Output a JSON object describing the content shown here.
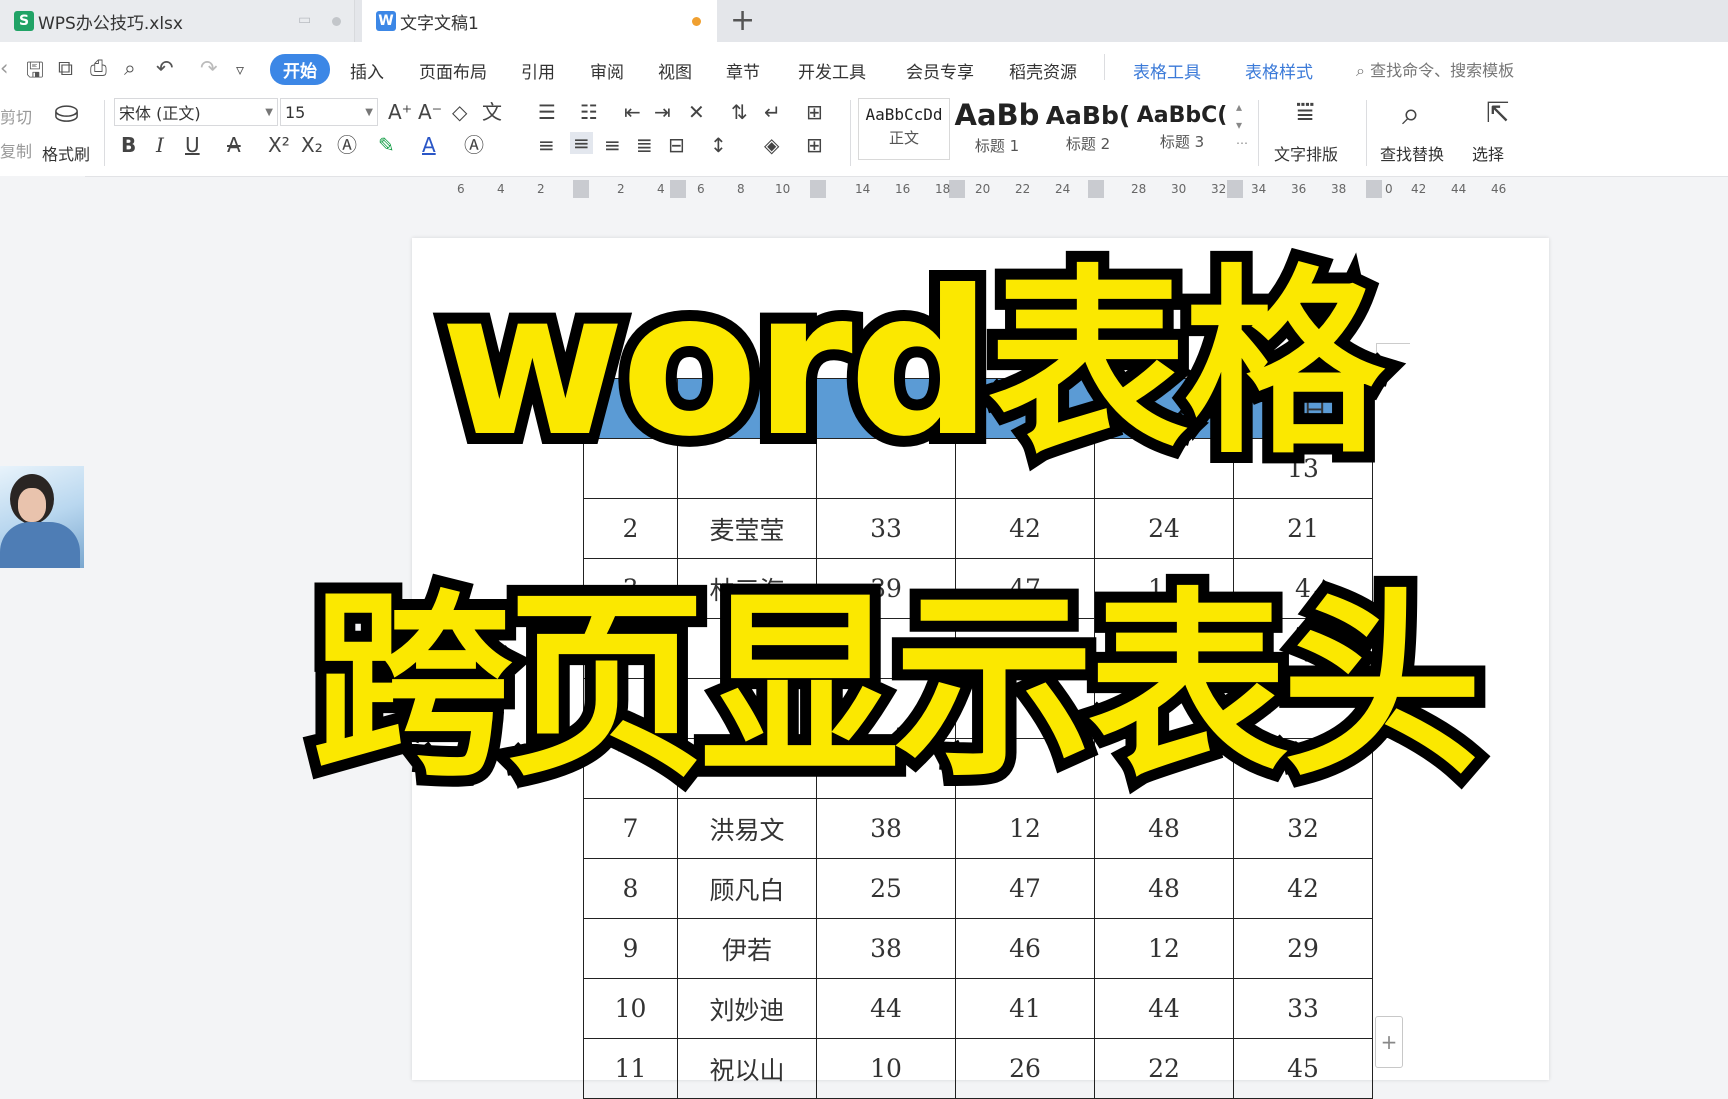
{
  "tabs": [
    {
      "icon_letter": "S",
      "icon_color": "#21a366",
      "title": "WPS办公技巧.xlsx"
    },
    {
      "icon_letter": "W",
      "icon_color": "#3c87e6",
      "title": "文字文稿1",
      "unsaved_dot_color": "#f0a030"
    }
  ],
  "new_tab_icon": "plus-icon",
  "menu": {
    "items": [
      "开始",
      "插入",
      "页面布局",
      "引用",
      "审阅",
      "视图",
      "章节",
      "开发工具",
      "会员专享",
      "稻壳资源"
    ],
    "active": "开始",
    "context_tabs": [
      "表格工具",
      "表格样式"
    ],
    "search_placeholder": "查找命令、搜索模板"
  },
  "ribbon": {
    "cut_label": "剪切",
    "copy_label": "复制",
    "format_painter_label": "格式刷",
    "font_name": "宋体 (正文)",
    "font_size": "15",
    "styles": [
      {
        "sample": "AaBbCcDd",
        "name": "正文"
      },
      {
        "sample": "AaBb",
        "name": "标题 1"
      },
      {
        "sample": "AaBb(",
        "name": "标题 2"
      },
      {
        "sample": "AaBbC(",
        "name": "标题 3"
      }
    ],
    "text_layout_label": "文字排版",
    "find_replace_label": "查找替换",
    "select_label": "选择"
  },
  "ruler_ticks": [
    "6",
    "4",
    "2",
    "2",
    "4",
    "6",
    "8",
    "10",
    "14",
    "16",
    "18",
    "20",
    "22",
    "24",
    "28",
    "30",
    "32",
    "34",
    "36",
    "38",
    "0",
    "42",
    "44",
    "46"
  ],
  "table": {
    "header_fragment": "4 日",
    "header_color": "#5b9bd5",
    "rows": [
      [
        "",
        "",
        "",
        "",
        "",
        "13"
      ],
      [
        "2",
        "麦莹莹",
        "33",
        "42",
        "24",
        "21"
      ],
      [
        "3",
        "林三海",
        "39",
        "47",
        "15",
        "4"
      ],
      [
        "",
        "",
        "",
        "",
        "",
        ""
      ],
      [
        "",
        "",
        "",
        "",
        "",
        ""
      ],
      [
        "",
        "",
        "",
        "",
        "",
        "0"
      ],
      [
        "7",
        "洪易文",
        "38",
        "12",
        "48",
        "32"
      ],
      [
        "8",
        "顾凡白",
        "25",
        "47",
        "48",
        "42"
      ],
      [
        "9",
        "伊若",
        "38",
        "46",
        "12",
        "29"
      ],
      [
        "10",
        "刘妙迪",
        "44",
        "41",
        "44",
        "33"
      ],
      [
        "11",
        "祝以山",
        "10",
        "26",
        "22",
        "45"
      ]
    ]
  },
  "overlay": {
    "line1": "word表格",
    "line2": "跨页显示表头",
    "fill_color": "#fbe800",
    "stroke_color": "#000000"
  }
}
